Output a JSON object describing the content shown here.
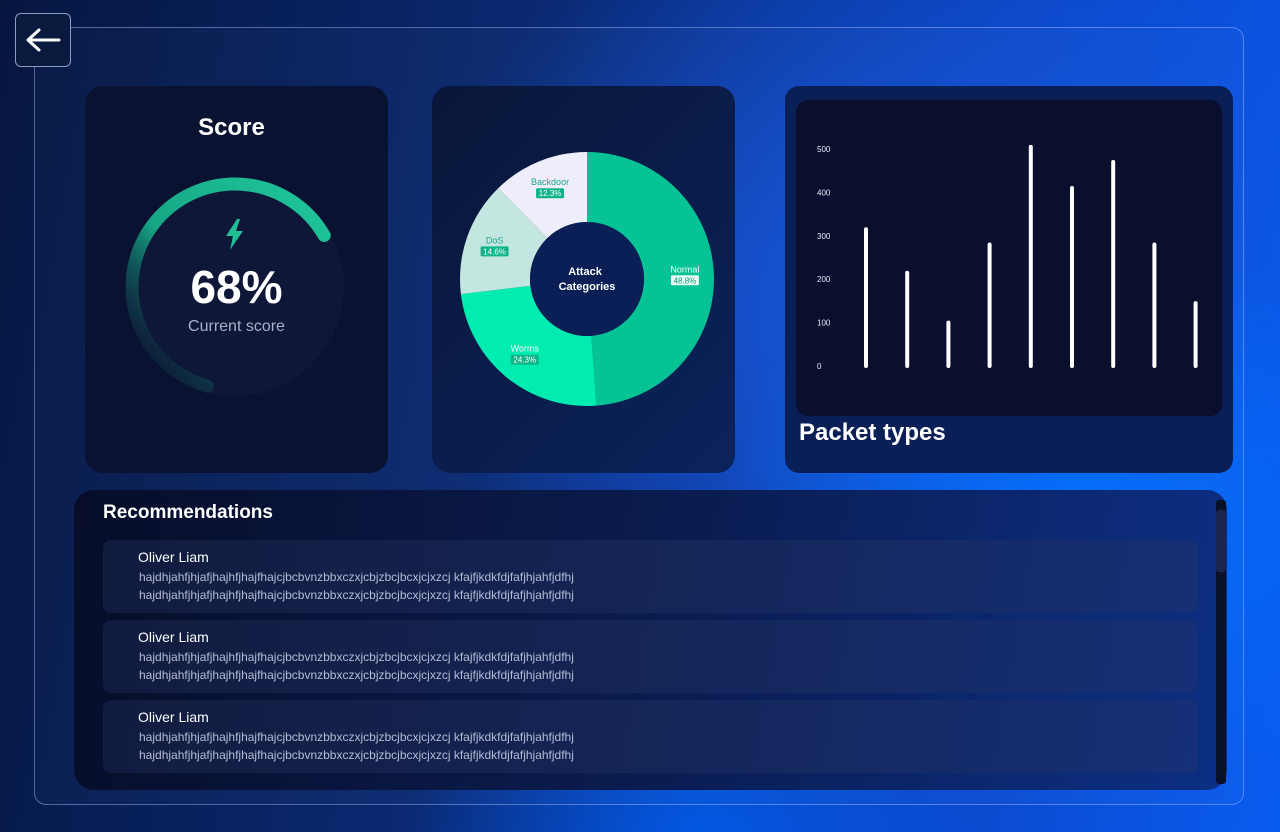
{
  "back": {
    "icon": "arrow-left-icon"
  },
  "score": {
    "title": "Score",
    "value": "68%",
    "percent": 68,
    "caption": "Current score",
    "icon": "lightning-icon",
    "accent": "#1fbf96"
  },
  "attack": {
    "center_line1": "Attack",
    "center_line2": "Categories",
    "chart_data": {
      "type": "pie",
      "slices": [
        {
          "label": "Normal",
          "value": 48.8,
          "pct": "48.8%",
          "color": "#05c394"
        },
        {
          "label": "Worms",
          "value": 24.3,
          "pct": "24.3%",
          "color": "#01ecb0"
        },
        {
          "label": "DoS",
          "value": 14.6,
          "pct": "14.6%",
          "color": "#c4e6e0"
        },
        {
          "label": "Backdoor",
          "value": 12.3,
          "pct": "12.3%",
          "color": "#eeeefa"
        }
      ]
    }
  },
  "packets": {
    "title": "Packet types",
    "chart_data": {
      "type": "bar",
      "values": [
        315,
        215,
        100,
        280,
        505,
        410,
        470,
        280,
        145
      ],
      "yticks": [
        "0",
        "100",
        "200",
        "300",
        "400",
        "500"
      ],
      "ylim": [
        0,
        500
      ],
      "grid": false
    }
  },
  "recommendations": {
    "title": "Recommendations",
    "items": [
      {
        "name": "Oliver Liam",
        "line1": "hajdhjahfjhjafjhajhfjhajfhajcjbcbvnzbbxczxjcbjzbcjbcxjcjxzcj kfajfjkdkfdjfafjhjahfjdfhj",
        "line2": "hajdhjahfjhjafjhajhfjhajfhajcjbcbvnzbbxczxjcbjzbcjbcxjcjxzcj kfajfjkdkfdjfafjhjahfjdfhj"
      },
      {
        "name": "Oliver Liam",
        "line1": "hajdhjahfjhjafjhajhfjhajfhajcjbcbvnzbbxczxjcbjzbcjbcxjcjxzcj kfajfjkdkfdjfafjhjahfjdfhj",
        "line2": "hajdhjahfjhjafjhajhfjhajfhajcjbcbvnzbbxczxjcbjzbcjbcxjcjxzcj kfajfjkdkfdjfafjhjahfjdfhj"
      },
      {
        "name": "Oliver Liam",
        "line1": "hajdhjahfjhjafjhajhfjhajfhajcjbcbvnzbbxczxjcbjzbcjbcxjcjxzcj kfajfjkdkfdjfafjhjahfjdfhj",
        "line2": "hajdhjahfjhjafjhajhfjhajfhajcjbcbvnzbbxczxjcbjzbcjbcxjcjxzcj kfajfjkdkfdjfafjhjahfjdfhj"
      }
    ]
  }
}
